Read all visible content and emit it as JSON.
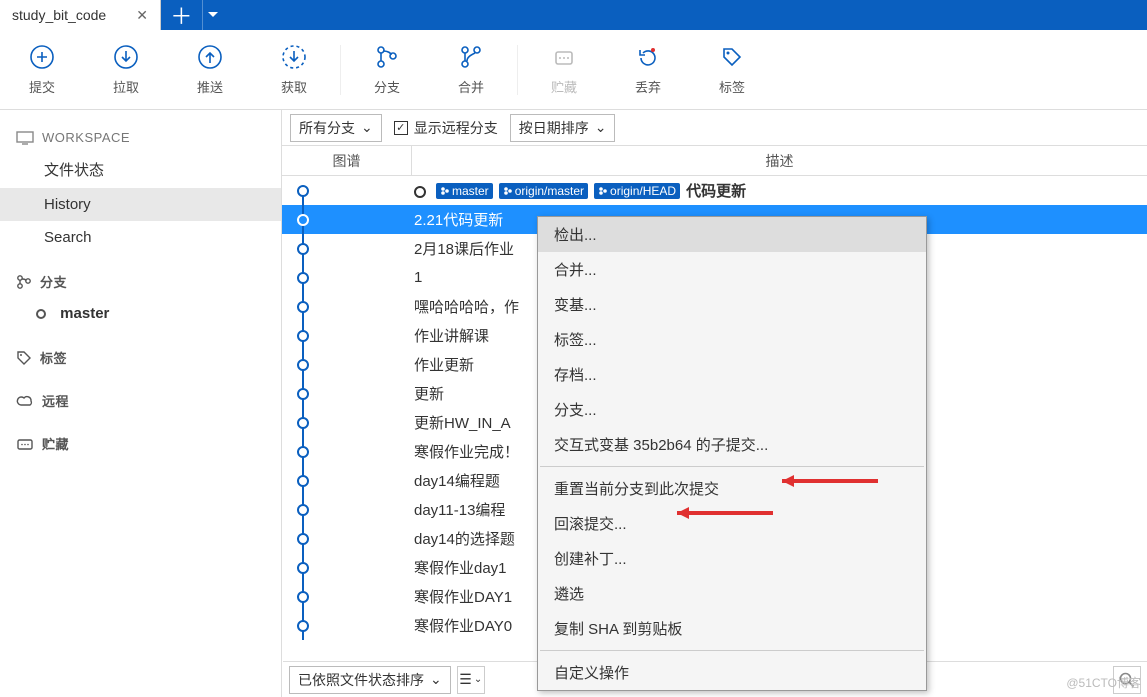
{
  "tab": {
    "title": "study_bit_code"
  },
  "toolbar": {
    "commit": "提交",
    "pull": "拉取",
    "push": "推送",
    "fetch": "获取",
    "branch": "分支",
    "merge": "合并",
    "stash": "贮藏",
    "discard": "丢弃",
    "tag": "标签"
  },
  "sidebar": {
    "workspace": "WORKSPACE",
    "filestatus": "文件状态",
    "history": "History",
    "search": "Search",
    "branches_label": "分支",
    "branch_master": "master",
    "tags_label": "标签",
    "remotes_label": "远程",
    "stashes_label": "贮藏"
  },
  "filters": {
    "all_branches": "所有分支",
    "show_remote": "显示远程分支",
    "sort_by_date": "按日期排序"
  },
  "columns": {
    "graph": "图谱",
    "description": "描述"
  },
  "refs": {
    "master": "master",
    "origin_master": "origin/master",
    "origin_head": "origin/HEAD"
  },
  "commits": [
    {
      "msg": "代码更新",
      "head": true
    },
    {
      "msg": "2.21代码更新",
      "selected": true
    },
    {
      "msg": "2月18课后作业"
    },
    {
      "msg": "1"
    },
    {
      "msg": "嘿哈哈哈哈，作"
    },
    {
      "msg": "作业讲解课"
    },
    {
      "msg": "作业更新"
    },
    {
      "msg": "更新"
    },
    {
      "msg": "更新HW_IN_A"
    },
    {
      "msg": "寒假作业完成！"
    },
    {
      "msg": "day14编程题"
    },
    {
      "msg": "day11-13编程"
    },
    {
      "msg": "day14的选择题"
    },
    {
      "msg": "寒假作业day1"
    },
    {
      "msg": "寒假作业DAY1"
    },
    {
      "msg": "寒假作业DAY0"
    }
  ],
  "context_menu": {
    "checkout": "检出...",
    "merge": "合并...",
    "rebase": "变基...",
    "tag": "标签...",
    "archive": "存档...",
    "branch": "分支...",
    "interactive_rebase": "交互式变基 35b2b64 的子提交...",
    "reset_to": "重置当前分支到此次提交",
    "revert": "回滚提交...",
    "create_patch": "创建补丁...",
    "cherry_pick": "遴选",
    "copy_sha": "复制 SHA 到剪贴板",
    "custom_actions": "自定义操作"
  },
  "bottombar": {
    "sorted_by_filestatus": "已依照文件状态排序"
  },
  "watermark": "@51CTO博客"
}
